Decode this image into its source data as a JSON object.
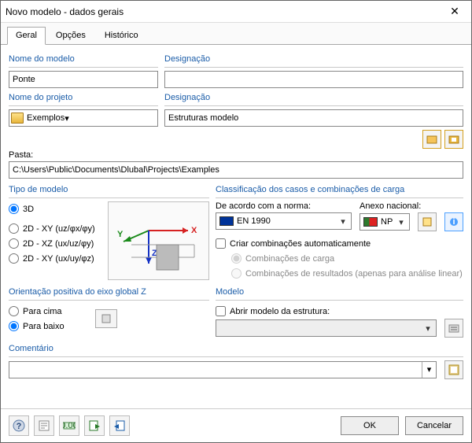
{
  "window": {
    "title": "Novo modelo - dados gerais"
  },
  "tabs": {
    "general": "Geral",
    "options": "Opções",
    "history": "Histórico"
  },
  "section_model_name": {
    "label": "Nome do modelo",
    "value": "Ponte"
  },
  "section_designation1": {
    "label": "Designação",
    "value": ""
  },
  "section_project": {
    "label": "Nome do projeto",
    "value": "Exemplos"
  },
  "section_designation2": {
    "label": "Designação",
    "value": "Estruturas modelo"
  },
  "section_folder": {
    "label": "Pasta:",
    "value": "C:\\Users\\Public\\Documents\\Dlubal\\Projects\\Examples"
  },
  "modeltype": {
    "label": "Tipo de modelo",
    "opt3d": "3D",
    "opt2dxy1": "2D - XY (uz/φx/φy)",
    "opt2dxz": "2D - XZ (ux/uz/φy)",
    "opt2dxy2": "2D - XY (ux/uy/φz)"
  },
  "classification": {
    "label": "Classificação dos casos e combinações de carga",
    "standard_label": "De acordo com a norma:",
    "standard_value": "EN 1990",
    "annex_label": "Anexo nacional:",
    "annex_value": "NP",
    "auto_comb": "Criar combinações automaticamente",
    "comb_load": "Combinações de carga",
    "comb_results": "Combinações de resultados (apenas para análise linear)"
  },
  "zaxis": {
    "label": "Orientação positiva do eixo global Z",
    "up": "Para cima",
    "down": "Para baixo"
  },
  "template": {
    "label": "Modelo",
    "open": "Abrir modelo da estrutura:"
  },
  "comment": {
    "label": "Comentário",
    "value": ""
  },
  "buttons": {
    "ok": "OK",
    "cancel": "Cancelar"
  }
}
